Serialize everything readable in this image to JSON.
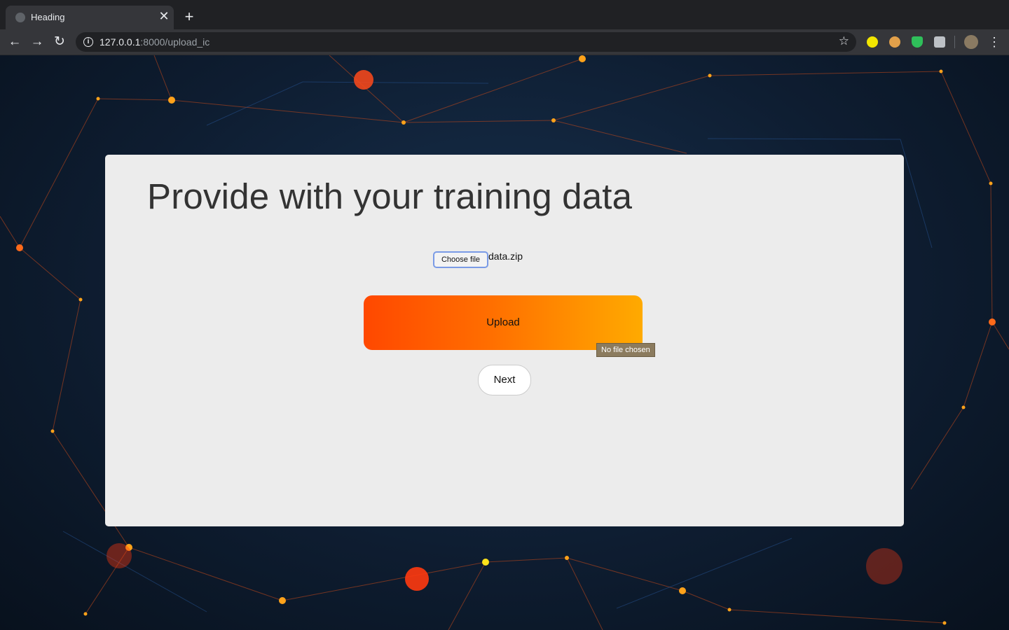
{
  "browser": {
    "tab": {
      "title": "Heading",
      "close": "✕"
    },
    "new_tab": "+",
    "nav": {
      "back": "←",
      "forward": "→",
      "reload": "↻"
    },
    "address": {
      "host": "127.0.0.1",
      "path": ":8000/upload_ic"
    },
    "bookmark": "☆",
    "menu": "⋮",
    "extensions": [
      "arrow-extension-icon",
      "cookie-extension-icon",
      "shield-extension-icon",
      "camera-extension-icon",
      "profile-avatar"
    ]
  },
  "page": {
    "heading": "Provide with your training data",
    "file_input": {
      "button_label": "Choose file",
      "file_name": "data.zip"
    },
    "upload_label": "Upload",
    "tooltip": "No file chosen",
    "next_label": "Next"
  },
  "colors": {
    "upload_gradient_start": "#ff4800",
    "upload_gradient_end": "#ffaa00",
    "card_background": "#ececec",
    "tooltip_background": "#8b7b5e"
  }
}
